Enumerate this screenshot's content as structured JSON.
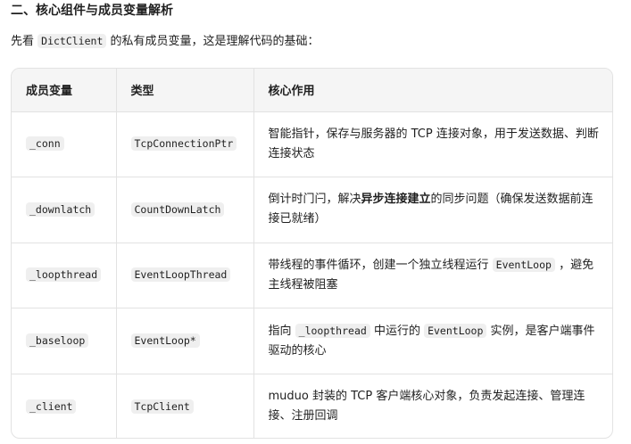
{
  "section_title": "二、核心组件与成员变量解析",
  "intro": {
    "prefix": "先看 ",
    "code": "DictClient",
    "suffix": " 的私有成员变量，这是理解代码的基础："
  },
  "table": {
    "headers": [
      "成员变量",
      "类型",
      "核心作用"
    ],
    "rows": [
      {
        "name": "_conn",
        "type": "TcpConnectionPtr",
        "desc": [
          {
            "t": "text",
            "v": "智能指针，保存与服务器的 TCP 连接对象，用于发送数据、判断连接状态"
          }
        ]
      },
      {
        "name": "_downlatch",
        "type": "CountDownLatch",
        "desc": [
          {
            "t": "text",
            "v": "倒计时门闩，解决"
          },
          {
            "t": "bold",
            "v": "异步连接建立"
          },
          {
            "t": "text",
            "v": "的同步问题（确保发送数据前连接已就绪）"
          }
        ]
      },
      {
        "name": "_loopthread",
        "type": "EventLoopThread",
        "desc": [
          {
            "t": "text",
            "v": "带线程的事件循环，创建一个独立线程运行 "
          },
          {
            "t": "code",
            "v": "EventLoop"
          },
          {
            "t": "text",
            "v": " ，避免主线程被阻塞"
          }
        ]
      },
      {
        "name": "_baseloop",
        "type": "EventLoop*",
        "desc": [
          {
            "t": "text",
            "v": "指向 "
          },
          {
            "t": "code",
            "v": "_loopthread"
          },
          {
            "t": "text",
            "v": " 中运行的 "
          },
          {
            "t": "code",
            "v": "EventLoop"
          },
          {
            "t": "text",
            "v": " 实例，是客户端事件驱动的核心"
          }
        ]
      },
      {
        "name": "_client",
        "type": "TcpClient",
        "desc": [
          {
            "t": "text",
            "v": "muduo 封装的 TCP 客户端核心对象，负责发起连接、管理连接、注册回调"
          }
        ]
      }
    ]
  }
}
